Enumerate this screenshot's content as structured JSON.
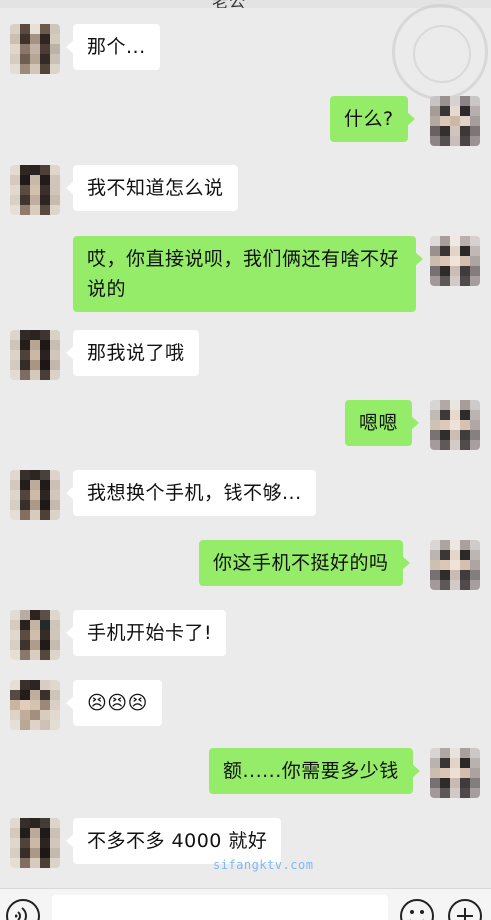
{
  "header": {
    "title": "老公"
  },
  "watermark": {
    "text": "sifangktv.com",
    "color": "#7ab8ff"
  },
  "colors": {
    "background": "#ebebeb",
    "bubble_in": "#ffffff",
    "bubble_out": "#95ec69"
  },
  "messages": [
    {
      "from": "other",
      "text": "那个..."
    },
    {
      "from": "me",
      "text": "什么?"
    },
    {
      "from": "other",
      "text": "我不知道怎么说"
    },
    {
      "from": "me",
      "text": "哎，你直接说呗，我们俩还有啥不好说的"
    },
    {
      "from": "other",
      "text": "那我说了哦"
    },
    {
      "from": "me",
      "text": "嗯嗯"
    },
    {
      "from": "other",
      "text": "我想换个手机，钱不够..."
    },
    {
      "from": "me",
      "text": "你这手机不挺好的吗"
    },
    {
      "from": "other",
      "text": "手机开始卡了!"
    },
    {
      "from": "other",
      "text": "😣😣😣",
      "icon": "persevering-face-emoji"
    },
    {
      "from": "me",
      "text": "额......你需要多少钱"
    },
    {
      "from": "other",
      "text": "不多不多 4000 就好",
      "icon": "grinning-sweat-face-emoji"
    }
  ],
  "input_bar": {
    "voice_icon": "voice-icon",
    "emoji_icon": "emoji-face-icon",
    "plus_icon": "plus-icon",
    "placeholder": ""
  }
}
